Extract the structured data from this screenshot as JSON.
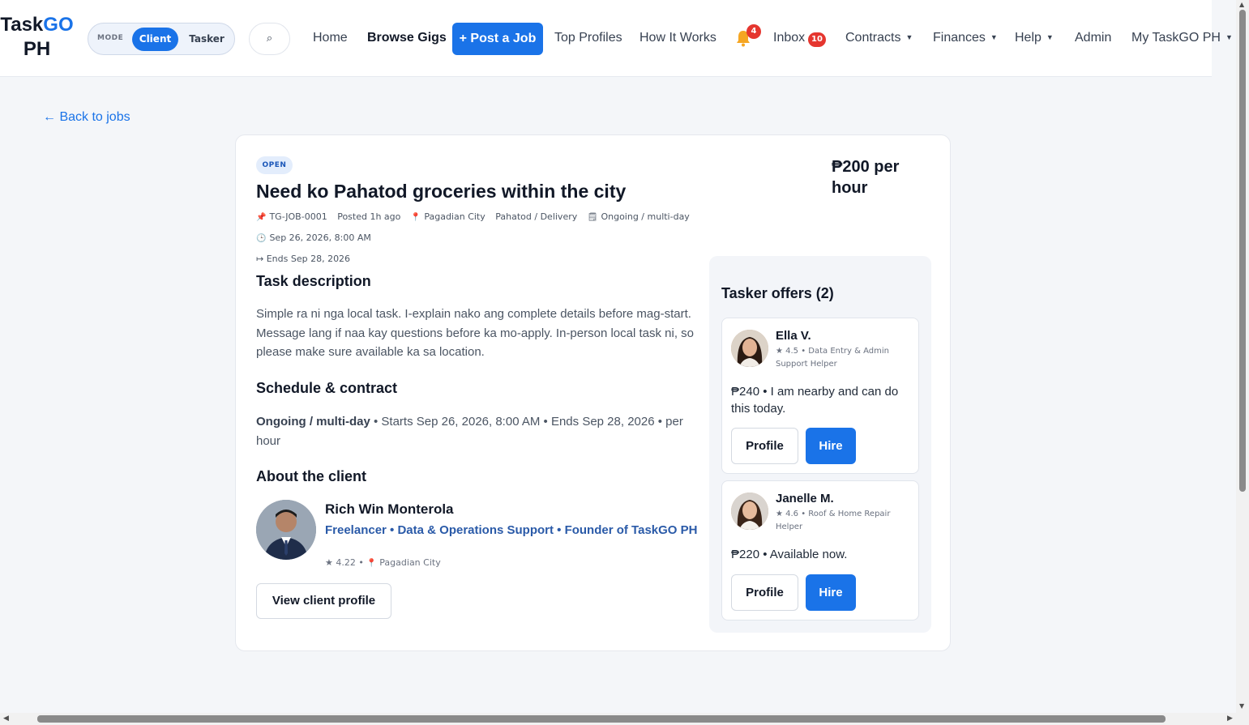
{
  "brand": {
    "name_part1": "Task",
    "name_part2": "GO",
    "name_part3": "PH"
  },
  "mode": {
    "label": "MODE",
    "client": "Client",
    "tasker": "Tasker"
  },
  "search": {
    "icon": "⌕"
  },
  "nav": {
    "home": "Home",
    "browse_gigs": "Browse Gigs",
    "post_job": "+ Post a Job",
    "top_profiles": "Top Profiles",
    "how_it_works": "How It Works",
    "notifications_count": "4",
    "inbox": "Inbox",
    "inbox_count": "10",
    "contracts": "Contracts",
    "finances": "Finances",
    "help": "Help",
    "admin": "Admin",
    "account": "My TaskGO PH",
    "caret": "▼"
  },
  "back_link": "← Back to jobs",
  "job": {
    "status": "OPEN",
    "title": "Need ko Pahatod groceries within the city",
    "price": "₱200 per hour",
    "meta": {
      "job_id": "TG-JOB-0001",
      "posted": "Posted 1h ago",
      "location": "Pagadian City",
      "category": "Pahatod / Delivery",
      "duration": "Ongoing / multi-day",
      "start": "Sep 26, 2026, 8:00 AM",
      "end": "↦ Ends Sep 28, 2026"
    },
    "description_heading": "Task description",
    "description": "Simple ra ni nga local task. I-explain nako ang complete details before mag-start. Message lang if naa kay questions before ka mo-apply. In-person local task ni, so please make sure available ka sa location.",
    "schedule_heading": "Schedule & contract",
    "schedule_type": "Ongoing / multi-day",
    "schedule_rest": " • Starts Sep 26, 2026, 8:00 AM • Ends Sep 28, 2026 • per hour"
  },
  "client": {
    "heading": "About the client",
    "name": "Rich Win Monterola",
    "role": "Freelancer • Data & Operations Support • Founder of TaskGO PH",
    "rating": "★ 4.22 •",
    "location": "Pagadian City",
    "view_profile": "View client profile"
  },
  "offers": {
    "title": "Tasker offers (2)",
    "items": [
      {
        "name": "Ella V.",
        "sub": "★ 4.5 • Data Entry & Admin Support Helper",
        "message": "₱240 • I am nearby and can do this today.",
        "profile": "Profile",
        "hire": "Hire"
      },
      {
        "name": "Janelle M.",
        "sub": "★ 4.6 • Roof & Home Repair Helper",
        "message": "₱220 • Available now.",
        "profile": "Profile",
        "hire": "Hire"
      }
    ]
  },
  "colors": {
    "accent": "#1a73e8",
    "badge_red": "#e5362f",
    "open_bg": "#e3edfc"
  }
}
